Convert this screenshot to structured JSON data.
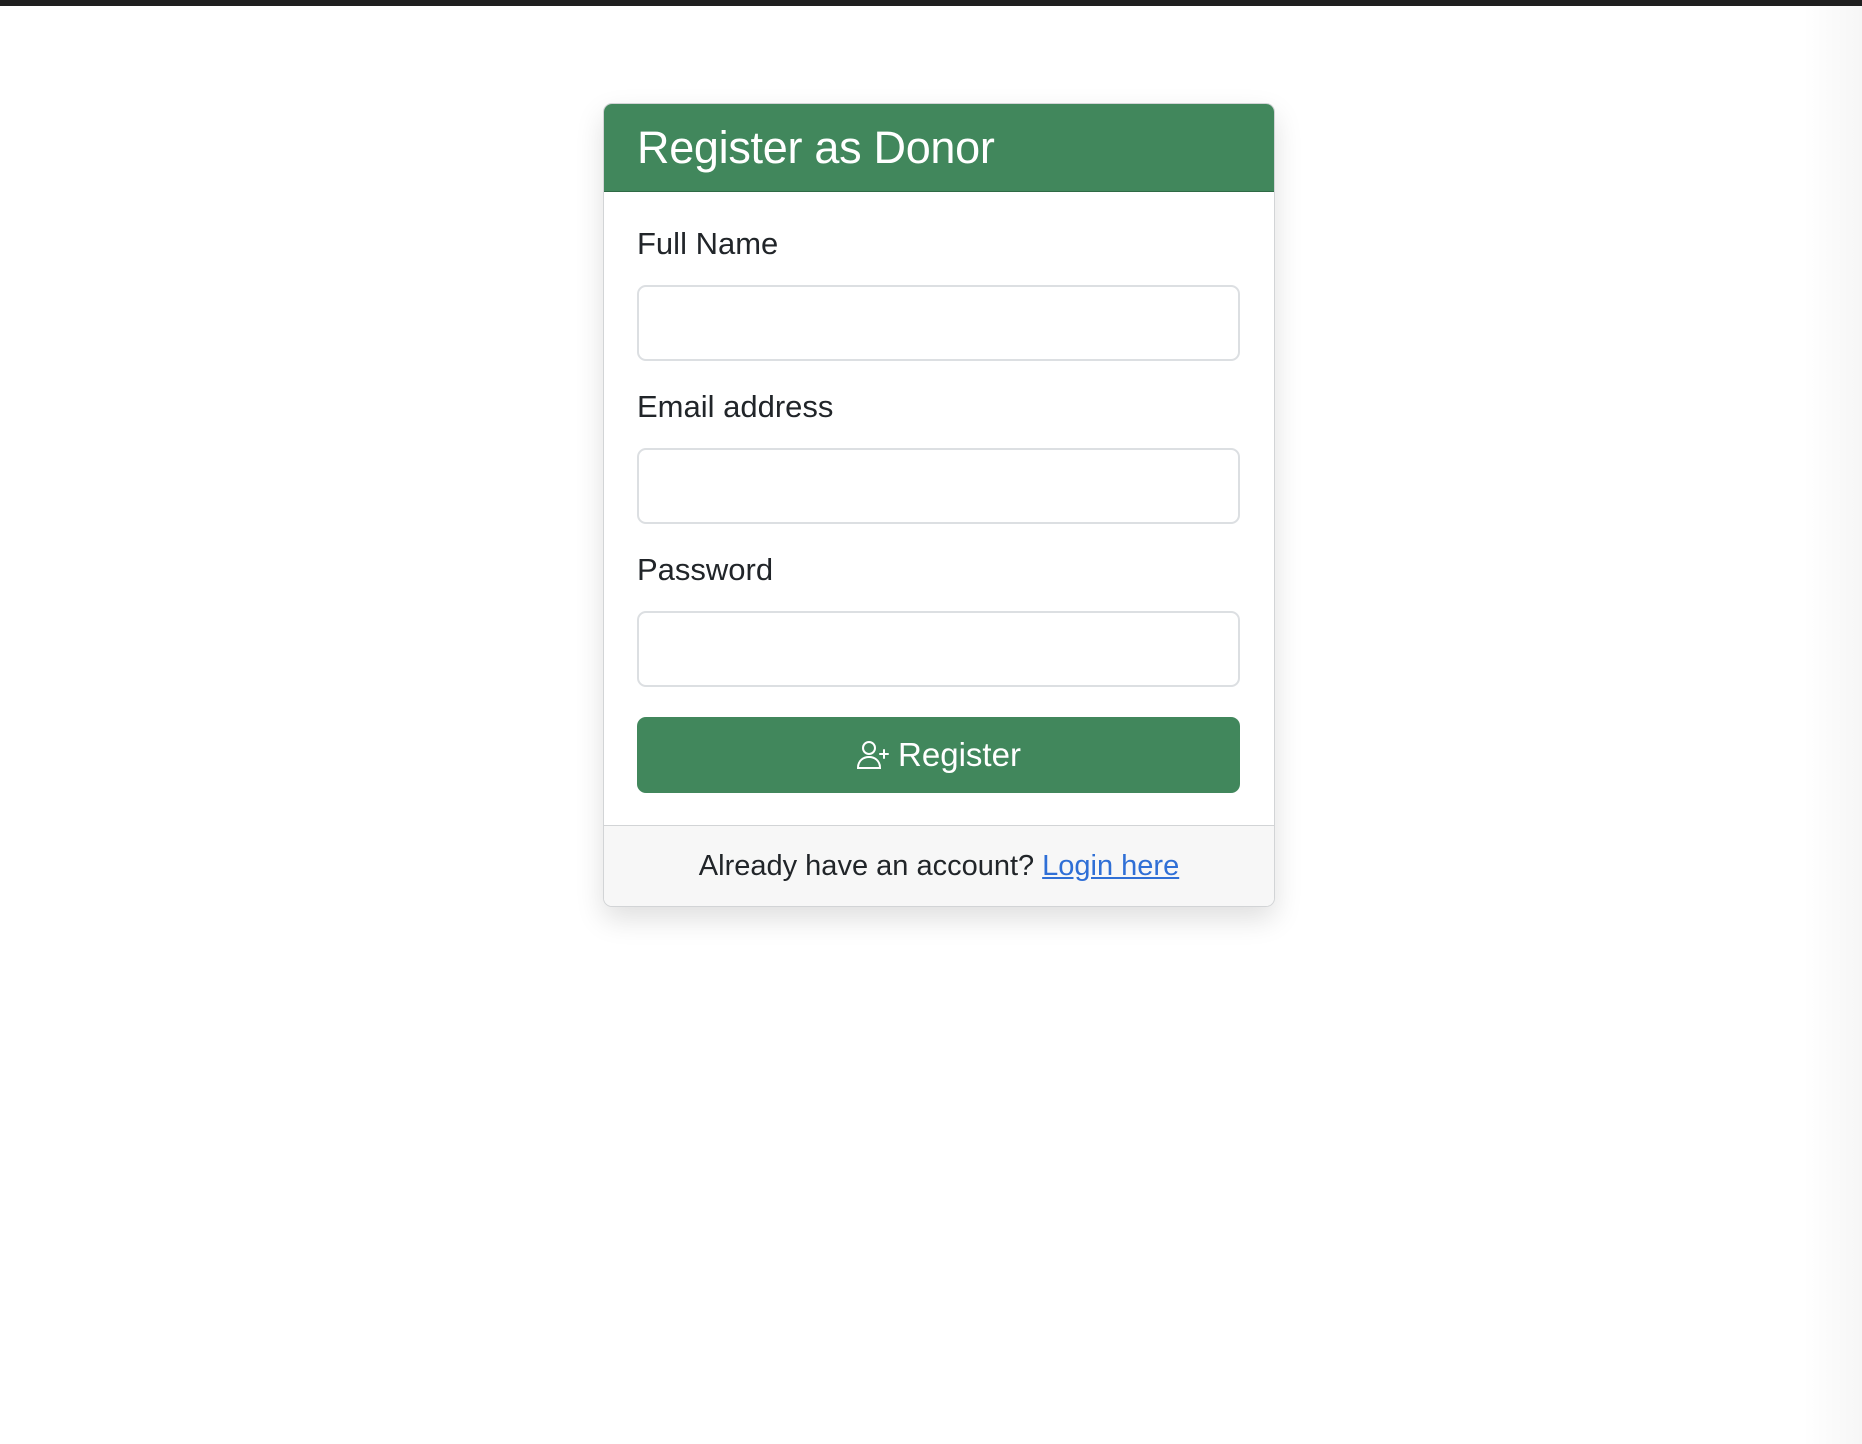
{
  "form": {
    "title": "Register as Donor",
    "fields": [
      {
        "label": "Full Name",
        "value": "",
        "placeholder": ""
      },
      {
        "label": "Email address",
        "value": "",
        "placeholder": ""
      },
      {
        "label": "Password",
        "value": "",
        "placeholder": ""
      }
    ],
    "submit_label": "Register",
    "submit_icon": "person-plus-icon"
  },
  "footer": {
    "prompt": "Already have an account?",
    "link_label": "Login here"
  },
  "colors": {
    "brand": "#41875c",
    "link": "#2f6fd6"
  }
}
